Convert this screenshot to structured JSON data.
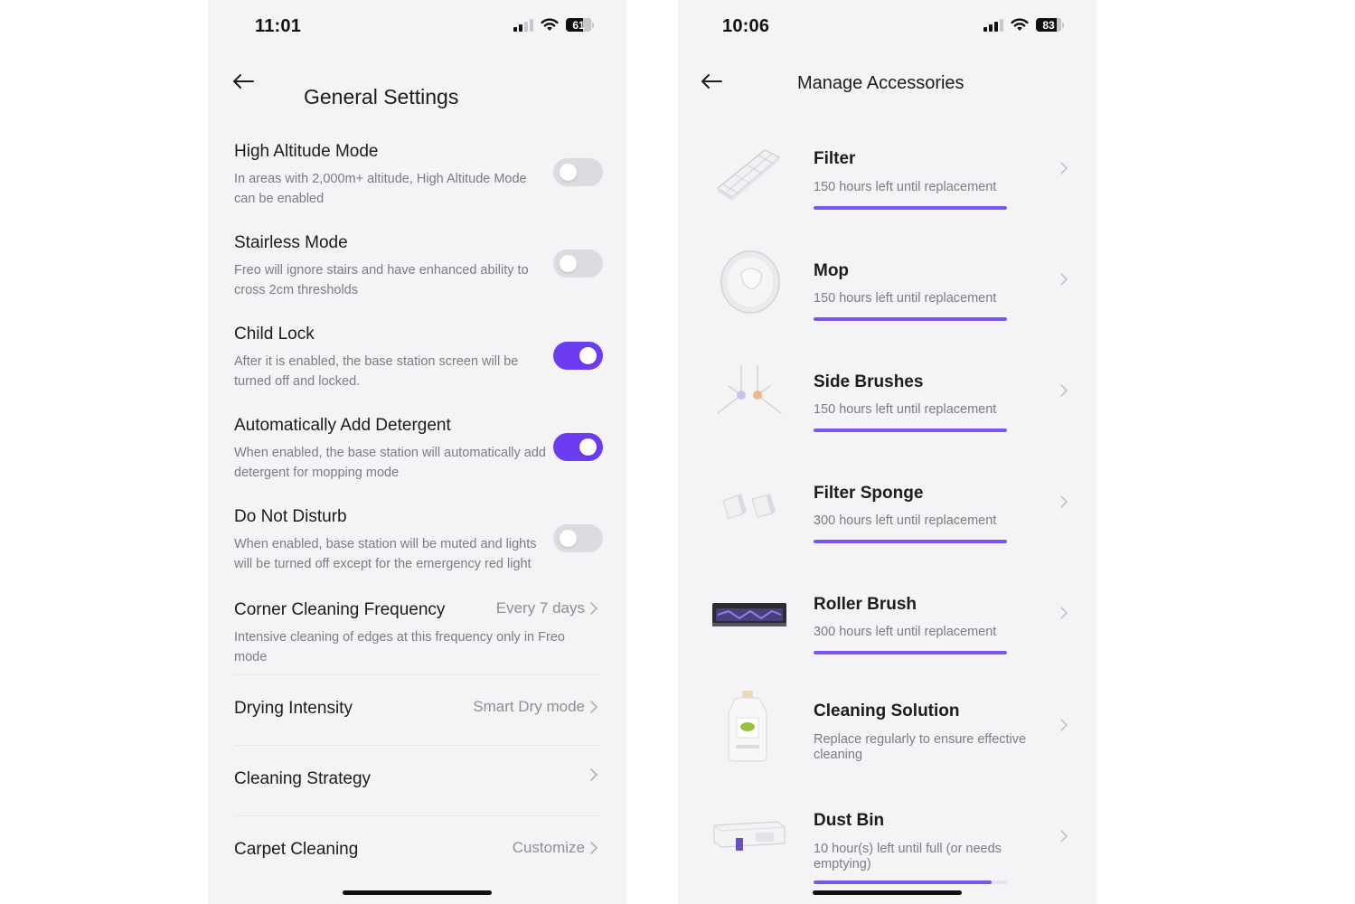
{
  "left": {
    "status": {
      "time": "11:01",
      "battery": "61",
      "battery_level": 0.61
    },
    "title": "General Settings",
    "settings": [
      {
        "title": "High Altitude Mode",
        "desc": "In areas with 2,000m+ altitude, High Altitude Mode can be enabled",
        "toggle": "off"
      },
      {
        "title": "Stairless Mode",
        "desc": "Freo will ignore stairs and have enhanced ability to cross 2cm thresholds",
        "toggle": "off"
      },
      {
        "title": "Child Lock",
        "desc": "After it is enabled, the base station screen will be turned off and locked.",
        "toggle": "on"
      },
      {
        "title": "Automatically Add Detergent",
        "desc": "When enabled, the base station will automatically add detergent for mopping mode",
        "toggle": "on"
      },
      {
        "title": "Do Not Disturb",
        "desc": "When enabled, base station will be muted and lights will be turned off except for the emergency red light",
        "toggle": "off"
      },
      {
        "title": "Corner Cleaning Frequency",
        "value": "Every 7 days",
        "desc": "Intensive cleaning of edges at this frequency only in Freo mode"
      },
      {
        "title": "Drying Intensity",
        "value": "Smart Dry mode"
      },
      {
        "title": "Cleaning Strategy",
        "value": ""
      },
      {
        "title": "Carpet Cleaning",
        "value": "Customize"
      }
    ]
  },
  "right": {
    "status": {
      "time": "10:06",
      "battery": "83",
      "battery_level": 0.83
    },
    "title": "Manage Accessories",
    "accessories": [
      {
        "name": "Filter",
        "sub": "150 hours left until replacement",
        "remaining": 1.0,
        "icon": "filter-icon"
      },
      {
        "name": "Mop",
        "sub": "150 hours left until replacement",
        "remaining": 1.0,
        "icon": "mop-pad-icon"
      },
      {
        "name": "Side Brushes",
        "sub": "150 hours left until replacement",
        "remaining": 1.0,
        "icon": "side-brush-icon"
      },
      {
        "name": "Filter Sponge",
        "sub": "300 hours left until replacement",
        "remaining": 1.0,
        "icon": "sponge-icon"
      },
      {
        "name": "Roller Brush",
        "sub": "300 hours left until replacement",
        "remaining": 1.0,
        "icon": "roller-brush-icon"
      },
      {
        "name": "Cleaning Solution",
        "sub": "Replace regularly to ensure effective cleaning",
        "icon": "solution-bottle-icon"
      },
      {
        "name": "Dust Bin",
        "sub": "10 hour(s) left until full (or needs emptying)",
        "remaining": 0.92,
        "icon": "dust-bin-icon"
      }
    ]
  },
  "colors": {
    "accent": "#6b3cf0",
    "bar": "#7a55ee",
    "background": "#f4f4f7"
  }
}
